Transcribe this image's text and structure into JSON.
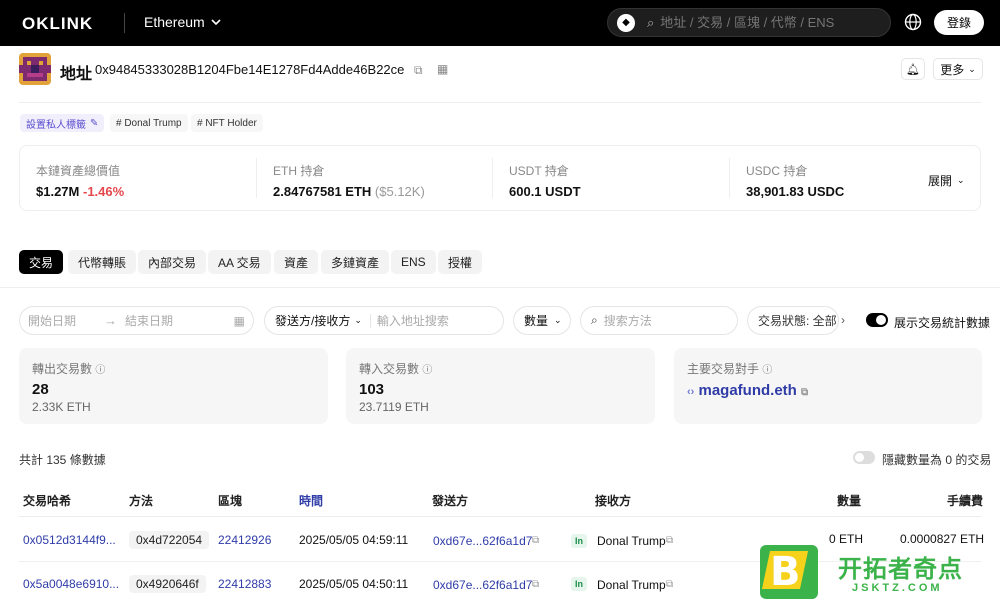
{
  "header": {
    "brand": "OKLINK",
    "chain": "Ethereum",
    "search_placeholder": "地址 / 交易 / 區塊 / 代幣 / ENS",
    "login": "登錄"
  },
  "address": {
    "title": "地址",
    "hash": "0x94845333028B1204Fbe14E1278Fd4Adde46B22ce",
    "more": "更多"
  },
  "tags": {
    "private": "設置私人標籤",
    "items": [
      "# Donal Trump",
      "# NFT Holder"
    ]
  },
  "holdings": {
    "items": [
      {
        "label": "本鏈資產總價值",
        "value": "$1.27M",
        "change": "-1.46%"
      },
      {
        "label": "ETH 持倉",
        "value": "2.84767581 ETH",
        "extra": "($5.12K)"
      },
      {
        "label": "USDT 持倉",
        "value": "600.1 USDT"
      },
      {
        "label": "USDC 持倉",
        "value": "38,901.83 USDC"
      }
    ],
    "expand": "展開"
  },
  "tabs": [
    "交易",
    "代幣轉賬",
    "內部交易",
    "AA 交易",
    "資產",
    "多鏈資產",
    "ENS",
    "授權"
  ],
  "filters": {
    "start_date": "開始日期",
    "end_date": "結束日期",
    "direction": "發送方/接收方",
    "address_placeholder": "輸入地址搜索",
    "quantity": "數量",
    "method_placeholder": "搜索方法",
    "status": "交易狀態: 全部",
    "show_stats": "展示交易統計數據"
  },
  "stats": {
    "out": {
      "label": "轉出交易數",
      "count": "28",
      "amount": "2.33K ETH"
    },
    "in": {
      "label": "轉入交易數",
      "count": "103",
      "amount": "23.7119 ETH"
    },
    "counterparty": {
      "label": "主要交易對手",
      "name": "magafund.eth"
    }
  },
  "summary": {
    "total": "共計 135 條數據",
    "hide_zero": "隱藏數量為 0 的交易"
  },
  "table": {
    "headers": [
      "交易哈希",
      "方法",
      "區塊",
      "時間",
      "發送方",
      "接收方",
      "數量",
      "手續費"
    ],
    "rows": [
      {
        "hash": "0x0512d3144f9...",
        "method": "0x4d722054",
        "block": "22412926",
        "time": "2025/05/05 04:59:11",
        "from": "0xd67e...62f6a1d7",
        "dir": "In",
        "to": "Donal Trump",
        "amount": "0 ETH",
        "fee": "0.0000827 ETH"
      },
      {
        "hash": "0x5a0048e6910...",
        "method": "0x4920646f",
        "block": "22412883",
        "time": "2025/05/05 04:50:11",
        "from": "0xd67e...62f6a1d7",
        "dir": "In",
        "to": "Donal Trump",
        "amount": "",
        "fee": ""
      }
    ]
  },
  "watermark": {
    "letter": "B",
    "cn": "开拓者奇点",
    "en": "JSKTZ.COM"
  }
}
